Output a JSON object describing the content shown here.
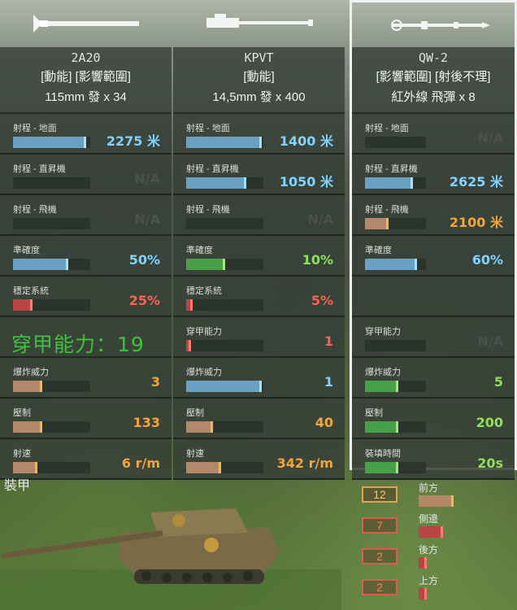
{
  "weapons": [
    {
      "name": "2A20",
      "tags": "[動能] [影響範圍]",
      "ammo": "115mm 發 x 34",
      "stats": [
        {
          "label": "射程 - 地面",
          "value": "2275 米",
          "pct": 0.95,
          "color": "blue"
        },
        {
          "label": "射程 - 直昇機",
          "value": "N/A",
          "pct": 0,
          "color": "none"
        },
        {
          "label": "射程 - 飛機",
          "value": "N/A",
          "pct": 0,
          "color": "none"
        },
        {
          "label": "準確度",
          "value": "50%",
          "pct": 0.72,
          "color": "blue"
        },
        {
          "label": "穩定系統",
          "value": "25%",
          "pct": 0.25,
          "color": "red"
        },
        {
          "label": "穿甲能力：19",
          "value": "",
          "pct": 0,
          "color": "big"
        },
        {
          "label": "爆炸威力",
          "value": "3",
          "pct": 0.38,
          "color": "orange"
        },
        {
          "label": "壓制",
          "value": "133",
          "pct": 0.38,
          "color": "orange"
        },
        {
          "label": "射速",
          "value": "6 r/m",
          "pct": 0.32,
          "color": "orange"
        }
      ]
    },
    {
      "name": "KPVT",
      "tags": "[動能]",
      "ammo": "14,5mm 發 x 400",
      "stats": [
        {
          "label": "射程 - 地面",
          "value": "1400 米",
          "pct": 0.98,
          "color": "blue"
        },
        {
          "label": "射程 - 直昇機",
          "value": "1050 米",
          "pct": 0.78,
          "color": "blue"
        },
        {
          "label": "射程 - 飛機",
          "value": "N/A",
          "pct": 0,
          "color": "none"
        },
        {
          "label": "準確度",
          "value": "10%",
          "pct": 0.5,
          "color": "green"
        },
        {
          "label": "穩定系統",
          "value": "5%",
          "pct": 0.08,
          "color": "red"
        },
        {
          "label": "穿甲能力",
          "value": "1",
          "pct": 0.06,
          "color": "red"
        },
        {
          "label": "爆炸威力",
          "value": "1",
          "pct": 0.98,
          "color": "blue"
        },
        {
          "label": "壓制",
          "value": "40",
          "pct": 0.35,
          "color": "orange"
        },
        {
          "label": "射速",
          "value": "342 r/m",
          "pct": 0.45,
          "color": "orange"
        }
      ]
    },
    {
      "name": "QW-2",
      "tags": "[影響範圍] [射後不理]",
      "ammo": "紅外線 飛彈 x 8",
      "stats": [
        {
          "label": "射程 - 地面",
          "value": "N/A",
          "pct": 0,
          "color": "none"
        },
        {
          "label": "射程 - 直昇機",
          "value": "2625 米",
          "pct": 0.78,
          "color": "blue"
        },
        {
          "label": "射程 - 飛機",
          "value": "2100 米",
          "pct": 0.38,
          "color": "orange"
        },
        {
          "label": "準確度",
          "value": "60%",
          "pct": 0.85,
          "color": "blue"
        },
        {
          "label": "",
          "value": "",
          "pct": 0,
          "color": "empty"
        },
        {
          "label": "穿甲能力",
          "value": "N/A",
          "pct": 0,
          "color": "none"
        },
        {
          "label": "爆炸威力",
          "value": "5",
          "pct": 0.55,
          "color": "green"
        },
        {
          "label": "壓制",
          "value": "200",
          "pct": 0.55,
          "color": "green"
        },
        {
          "label": "裝填時間",
          "value": "20s",
          "pct": 0.55,
          "color": "green"
        }
      ]
    }
  ],
  "armor": {
    "title": "裝甲",
    "items": [
      {
        "label": "前方",
        "value": "12",
        "pct": 0.85,
        "kind": "front"
      },
      {
        "label": "側邊",
        "value": "7",
        "pct": 0.6,
        "kind": "side"
      },
      {
        "label": "後方",
        "value": "2",
        "pct": 0.2,
        "kind": "side"
      },
      {
        "label": "上方",
        "value": "2",
        "pct": 0.2,
        "kind": "side"
      }
    ]
  }
}
